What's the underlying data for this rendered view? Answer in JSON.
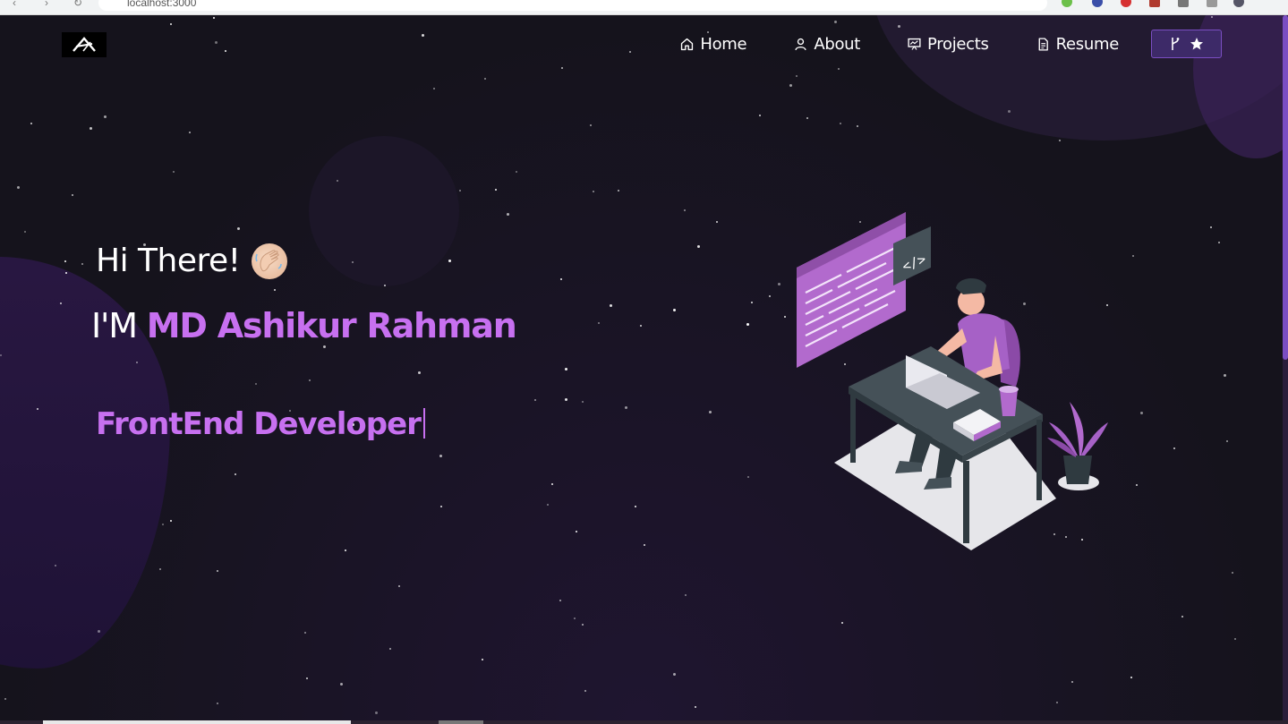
{
  "browser": {
    "url": "localhost:3000"
  },
  "navbar": {
    "logo_icon": "ashik-logo-icon",
    "items": [
      {
        "label": "Home",
        "icon": "home-icon"
      },
      {
        "label": "About",
        "icon": "user-icon"
      },
      {
        "label": "Projects",
        "icon": "projects-icon"
      },
      {
        "label": "Resume",
        "icon": "document-icon"
      }
    ],
    "fork_button": {
      "icons": [
        "git-fork-icon",
        "star-icon"
      ]
    }
  },
  "hero": {
    "greeting": "Hi There!",
    "greeting_icon": "waving-hand-icon",
    "intro_prefix": "I'M ",
    "name": "MD Ashikur Rahman",
    "role": "FrontEnd Developer"
  },
  "colors": {
    "accent": "#c770f0",
    "background": "#15131c",
    "button_bg": "#3d2a68"
  }
}
